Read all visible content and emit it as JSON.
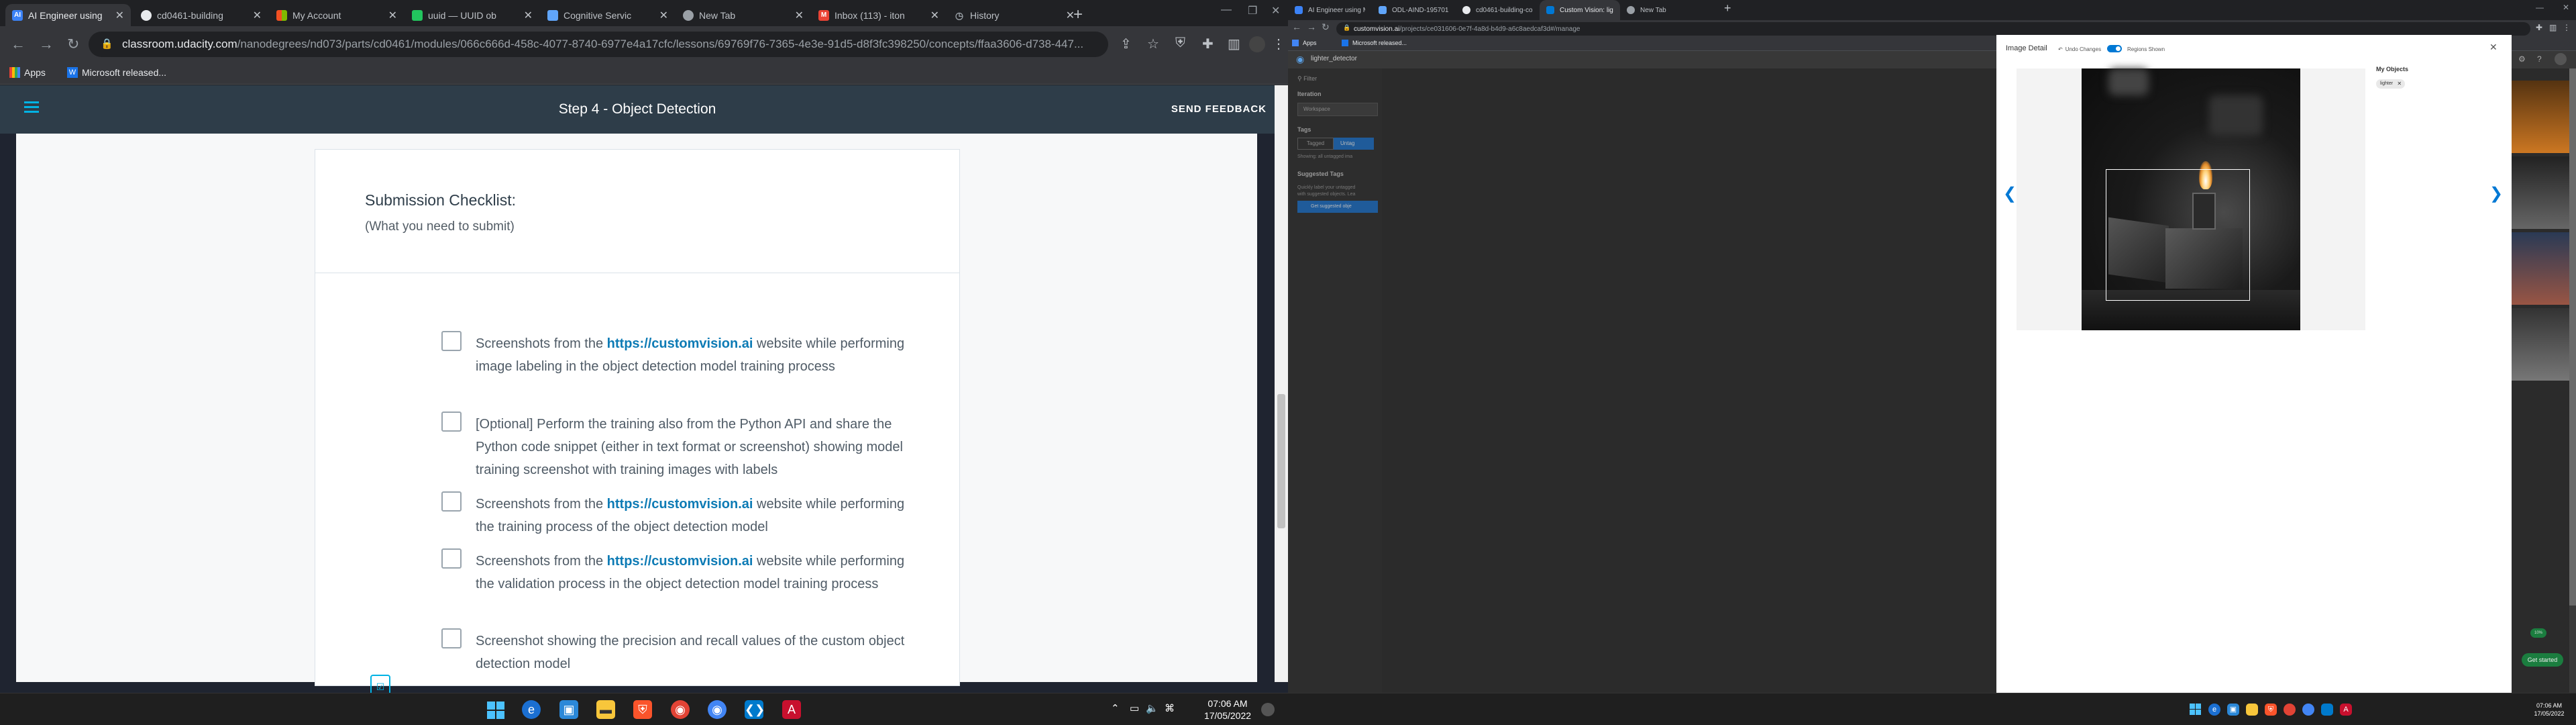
{
  "left": {
    "tabs": [
      {
        "title": "AI Engineer using",
        "fav": "AI",
        "color": "#3b82f6"
      },
      {
        "title": "cd0461-building",
        "fav": "",
        "color": "#e8eaed"
      },
      {
        "title": "My Account",
        "fav": "",
        "color": "#f59e0b"
      },
      {
        "title": "uuid — UUID ob",
        "fav": "",
        "color": "#22c55e"
      },
      {
        "title": "Cognitive Servic",
        "fav": "",
        "color": "#60a5fa"
      },
      {
        "title": "New Tab",
        "fav": "",
        "color": "#9aa0a6"
      },
      {
        "title": "Inbox (113) - iton",
        "fav": "M",
        "color": "#ea4335"
      },
      {
        "title": "History",
        "fav": "",
        "color": "#9aa0a6"
      }
    ],
    "url_host": "classroom.udacity.com",
    "url_path": "/nanodegrees/nd073/parts/cd0461/modules/066c666d-458c-4077-8740-6977e4a17cfc/lessons/69769f76-7365-4e3e-91d5-d8f3fc398250/concepts/ffaa3606-d738-447...",
    "bookmarks": [
      "Apps",
      "Microsoft released..."
    ],
    "header_title": "Step 4 - Object Detection",
    "send_feedback": "SEND FEEDBACK",
    "checklist_title": "Submission Checklist:",
    "checklist_subtitle": "(What you need to submit)",
    "items": [
      {
        "pre": "Screenshots from the ",
        "link": "https://customvision.ai",
        "post": " website while performing image labeling in the object detection model training process"
      },
      {
        "pre": "[Optional] Perform the training also from the Python API and share the Python code snippet (either in text format or screenshot) showing model training screenshot with training images with labels",
        "link": "",
        "post": ""
      },
      {
        "pre": "Screenshots from the ",
        "link": "https://customvision.ai",
        "post": " website while performing the training process of the object detection model"
      },
      {
        "pre": "Screenshots from the ",
        "link": "https://customvision.ai",
        "post": " website while performing the validation process in the object detection model training process"
      },
      {
        "pre": "Screenshot showing the precision and recall values of the custom object detection model",
        "link": "",
        "post": ""
      }
    ],
    "time": "07:06 AM",
    "date": "17/05/2022"
  },
  "right": {
    "tabs": [
      {
        "title": "AI Engineer using Microsoft Azu",
        "color": "#3b82f6"
      },
      {
        "title": "ODL-AIND-195701 - Microsoft A",
        "color": "#60a5fa"
      },
      {
        "title": "cd0461-building-computer-visio",
        "color": "#e8eaed"
      },
      {
        "title": "Custom Vision: lighter_detector",
        "color": "#0078d4"
      },
      {
        "title": "New Tab",
        "color": "#9aa0a6"
      }
    ],
    "url_host": "customvision.ai",
    "url_path": "/projects/ce031606-0e7f-4a8d-b4d9-a6c8aedcaf3d#/manage",
    "bookmarks": [
      "Apps",
      "Microsoft released..."
    ],
    "project_name": "lighter_detector",
    "filter": "Filter",
    "iteration_label": "Iteration",
    "iteration_value": "Workspace",
    "tags_label": "Tags",
    "tagged": "Tagged",
    "untagged": "Untag",
    "showing": "Showing: all untagged ima",
    "suggested_tags": "Suggested Tags",
    "suggested_desc_1": "Quickly label your untagged",
    "suggested_desc_2": "with suggested objects. Lea",
    "suggested_button": "Get suggested obje",
    "modal_title": "Image Detail",
    "undo": "Undo Changes",
    "regions_shown": "Regions Shown",
    "my_objects": "My Objects",
    "tag_chip": "lighter",
    "progress_badge": "10%",
    "get_started": "Get started",
    "time": "07:06 AM",
    "date": "17/05/2022"
  }
}
